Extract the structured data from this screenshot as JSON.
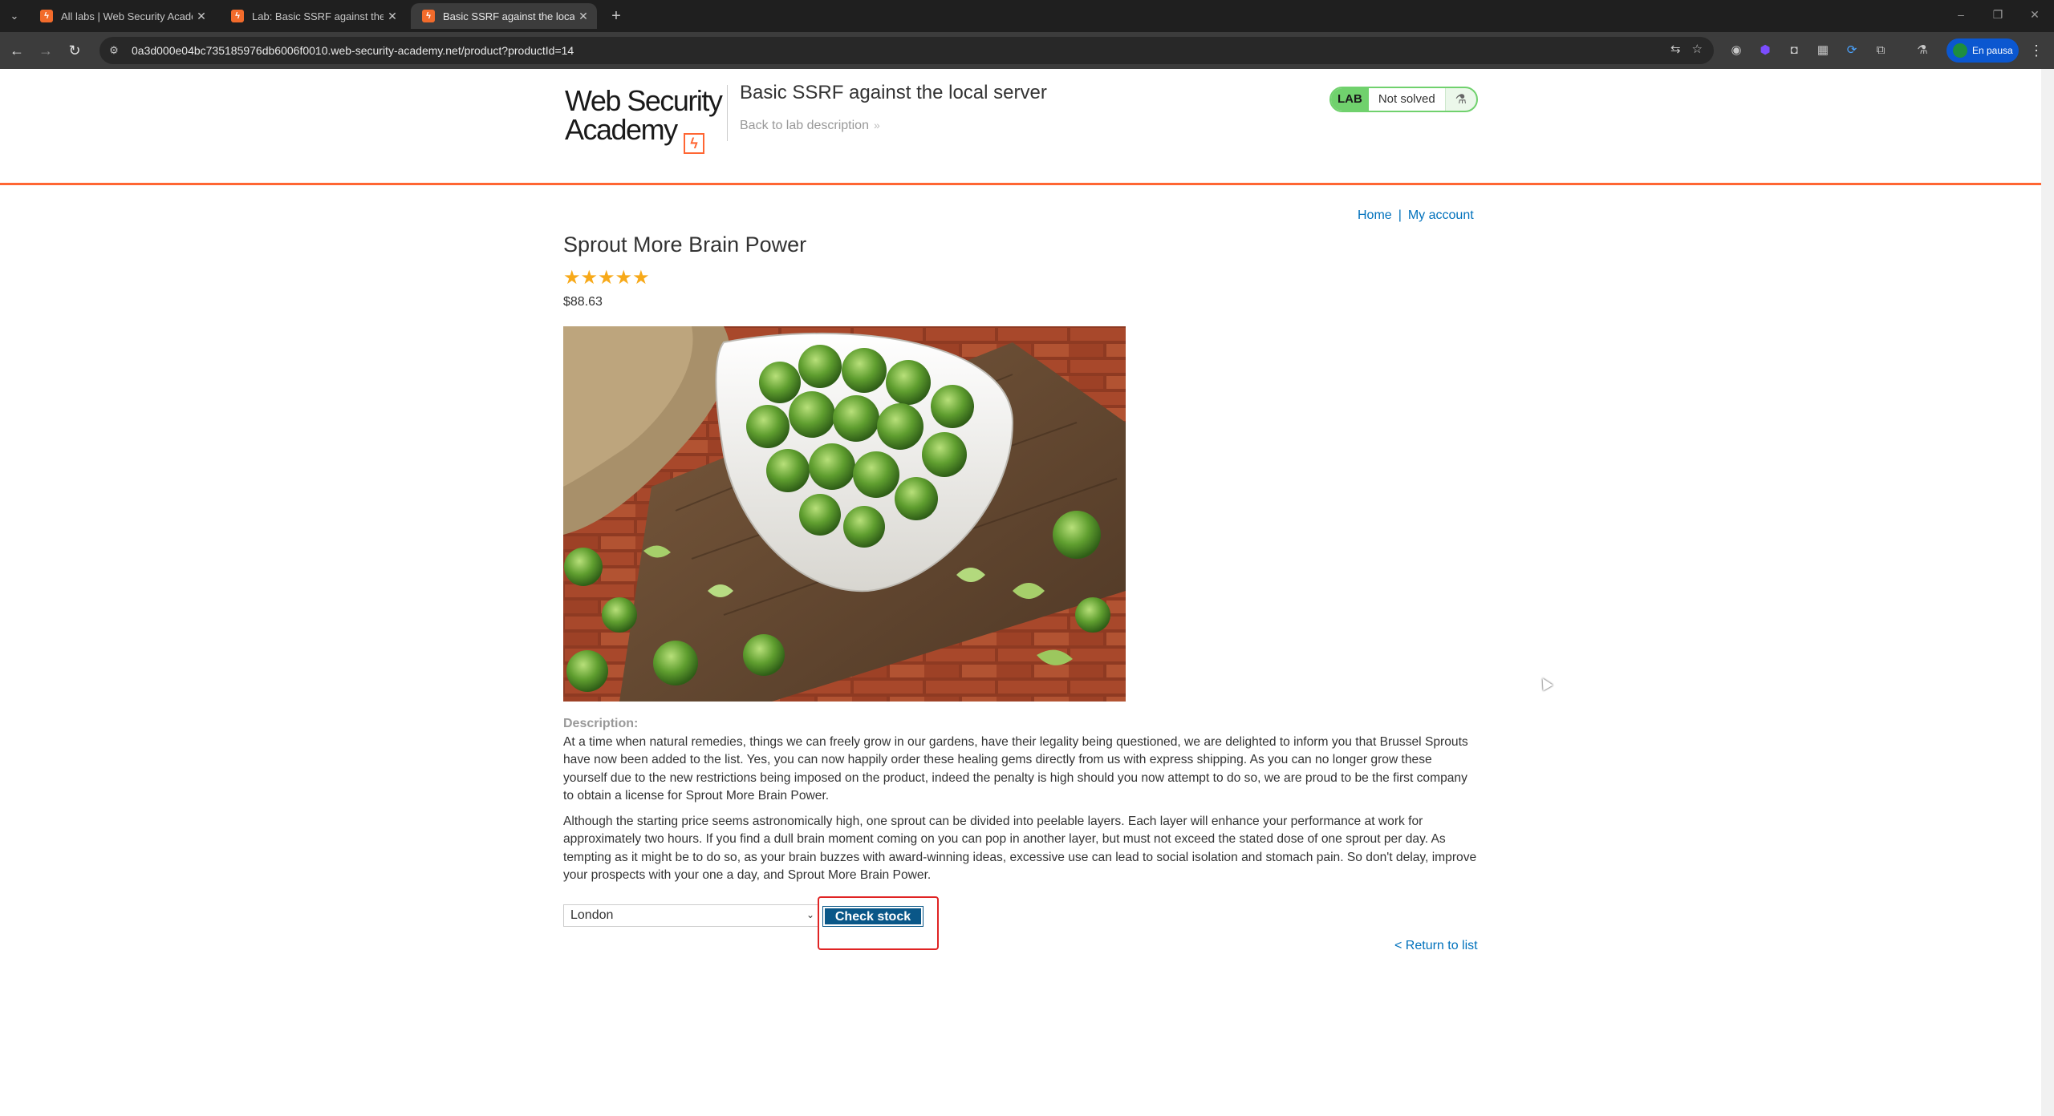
{
  "browser": {
    "tabs": [
      {
        "title": "All labs | Web Security Academy",
        "active": false
      },
      {
        "title": "Lab: Basic SSRF against the local server",
        "active": false
      },
      {
        "title": "Basic SSRF against the local server",
        "active": true
      }
    ],
    "url": "0a3d000e04bc735185976db6006f0010.web-security-academy.net/product?productId=14",
    "profile_label": "En pausa"
  },
  "header": {
    "logo_line1": "Web Security",
    "logo_line2": "Academy",
    "lab_title": "Basic SSRF against the local server",
    "back_link": "Back to lab description",
    "lab_badge": "LAB",
    "lab_status": "Not solved"
  },
  "nav": {
    "home": "Home",
    "separator": "|",
    "my_account": "My account"
  },
  "product": {
    "title": "Sprout More Brain Power",
    "rating_stars": "★★★★★",
    "rating": 5,
    "price": "$88.63",
    "description_label": "Description:",
    "description_p1": "At a time when natural remedies, things we can freely grow in our gardens, have their legality being questioned, we are delighted to inform you that Brussel Sprouts have now been added to the list. Yes, you can now happily order these healing gems directly from us with express shipping. As you can no longer grow these yourself due to the new restrictions being imposed on the product, indeed the penalty is high should you now attempt to do so, we are proud to be the first company to obtain a license for Sprout More Brain Power.",
    "description_p2": "Although the starting price seems astronomically high, one sprout can be divided into peelable layers. Each layer will enhance your performance at work for approximately two hours. If you find a dull brain moment coming on you can pop in another layer, but must not exceed the stated dose of one sprout per day. As tempting as it might be to do so, as your brain buzzes with award-winning ideas, excessive use can lead to social isolation and stomach pain. So don't delay, improve your prospects with your one a day, and Sprout More Brain Power."
  },
  "stock": {
    "selected_store": "London",
    "check_button": "Check stock"
  },
  "footer": {
    "return_link": "< Return to list"
  }
}
